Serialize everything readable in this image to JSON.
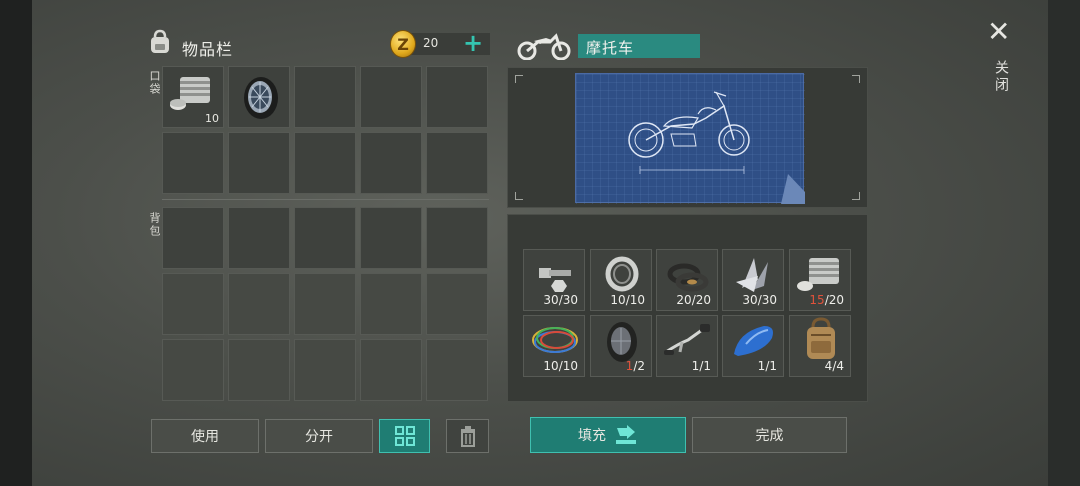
{
  "inventory": {
    "title": "物品栏",
    "coins": "20",
    "pocket_label": "口袋",
    "backpack_label": "背包",
    "pocket_slots": [
      {
        "item": "engine-part",
        "qty": "10"
      },
      {
        "item": "wheel",
        "qty": ""
      },
      {
        "item": "",
        "qty": ""
      },
      {
        "item": "",
        "qty": ""
      },
      {
        "item": "",
        "qty": ""
      },
      {
        "item": "",
        "qty": ""
      },
      {
        "item": "",
        "qty": ""
      },
      {
        "item": "",
        "qty": ""
      },
      {
        "item": "",
        "qty": ""
      },
      {
        "item": "",
        "qty": ""
      }
    ]
  },
  "buttons": {
    "use": "使用",
    "split": "分开",
    "fill": "填充",
    "done": "完成"
  },
  "vehicle": {
    "title": "摩托车"
  },
  "materials": [
    {
      "icon": "bolts-icon",
      "have": "30",
      "need": "/30",
      "short": false
    },
    {
      "icon": "bearing-icon",
      "have": "10",
      "need": "/10",
      "short": false
    },
    {
      "icon": "rubber-seals-icon",
      "have": "20",
      "need": "/20",
      "short": false
    },
    {
      "icon": "metal-shards-icon",
      "have": "30",
      "need": "/30",
      "short": false
    },
    {
      "icon": "engine-block-icon",
      "have": "15",
      "need": "/20",
      "short": true
    },
    {
      "icon": "wires-icon",
      "have": "10",
      "need": "/10",
      "short": false
    },
    {
      "icon": "wheel-icon",
      "have": "1",
      "need": "/2",
      "short": true
    },
    {
      "icon": "handlebar-icon",
      "have": "1",
      "need": "/1",
      "short": false
    },
    {
      "icon": "fuel-tank-icon",
      "have": "1",
      "need": "/1",
      "short": false
    },
    {
      "icon": "backpack-icon",
      "have": "4",
      "need": "/4",
      "short": false
    }
  ],
  "close": {
    "label": "关闭"
  },
  "colors": {
    "accent": "#34c5b1",
    "shortage": "#e0523b"
  }
}
